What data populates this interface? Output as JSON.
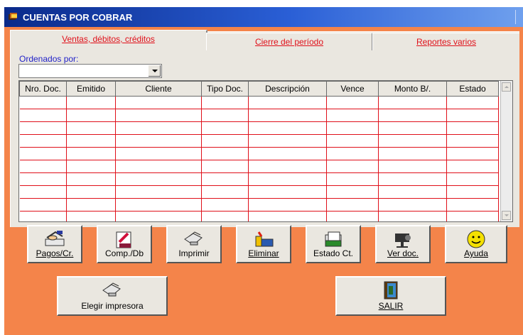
{
  "window": {
    "title": "CUENTAS POR COBRAR"
  },
  "tabs": [
    {
      "label": "Ventas, débitos, créditos",
      "active": true
    },
    {
      "label": "Cierre del período",
      "active": false
    },
    {
      "label": "Reportes varios",
      "active": false
    }
  ],
  "sort": {
    "label": "Ordenados por:",
    "value": ""
  },
  "table": {
    "columns": [
      "Nro. Doc.",
      "Emitido",
      "Cliente",
      "Tipo Doc.",
      "Descripción",
      "Vence",
      "Monto  B/.",
      "Estado"
    ],
    "row_count": 10
  },
  "toolbar": {
    "pagos": "Pagos/Cr.",
    "comp": "Comp./Db",
    "imprimir": "Imprimir",
    "eliminar": "Eliminar",
    "estado": "Estado Ct.",
    "verdoc": "Ver doc.",
    "ayuda": "Ayuda"
  },
  "bottom": {
    "elegir": "Elegir impresora",
    "salir": "SALIR"
  },
  "colors": {
    "background": "#f4844a",
    "panel": "#eae7e0",
    "grid_lines": "#e0101a",
    "tab_text": "#e0101a",
    "label_blue": "#2222c8",
    "title_bar": "#0a2a8a"
  }
}
